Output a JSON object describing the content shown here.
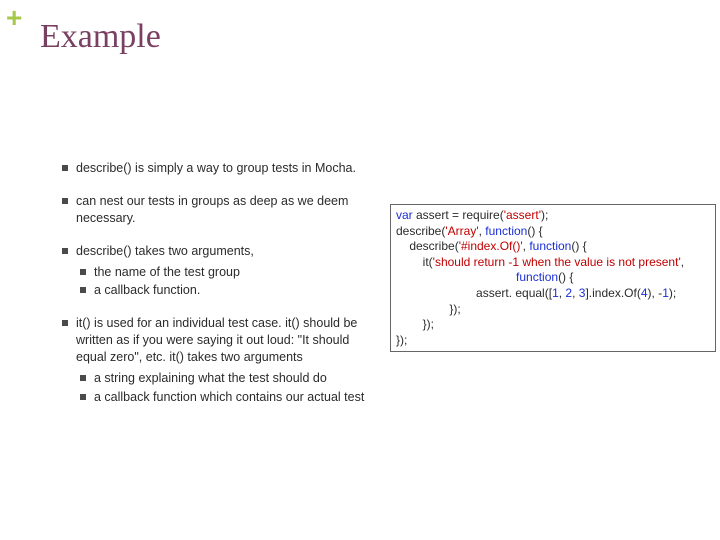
{
  "plus": "+",
  "title": "Example",
  "bullets": {
    "b0": "describe() is simply a way to group tests in Mocha.",
    "b1": "can nest our tests in groups as deep as we deem necessary.",
    "b2": "describe() takes two arguments,",
    "b2a": "the name of the test group",
    "b2b": "a callback function.",
    "b3": "it() is used for an individual test case. it() should be written as if you were saying it out loud: \"It should equal zero\", etc. it() takes two arguments",
    "b3a": "a string explaining what the test should do",
    "b3b": "a callback function which contains our actual test"
  },
  "code": {
    "l0a": "var",
    "l0b": " assert = require(",
    "l0c": "'assert'",
    "l0d": ");",
    "l1a": "describe(",
    "l1b": "'Array'",
    "l1c": ", ",
    "l1d": "function",
    "l1e": "() {",
    "l2a": "    describe(",
    "l2b": "'#index.Of()'",
    "l2c": ", ",
    "l2d": "function",
    "l2e": "() {",
    "l3a": "        it(",
    "l3b": "'should return -1 when the value is not present'",
    "l3c": ",",
    "l4a": "                                    ",
    "l4b": "function",
    "l4c": "() {",
    "l5a": "                        assert. equal([",
    "l5b": "1",
    "l5c": ", ",
    "l5d": "2",
    "l5e": ", ",
    "l5f": "3",
    "l5g": "].index.Of(",
    "l5h": "4",
    "l5i": "), -",
    "l5j": "1",
    "l5k": ");",
    "l6": "                });",
    "l7": "        });",
    "l8": "});"
  }
}
